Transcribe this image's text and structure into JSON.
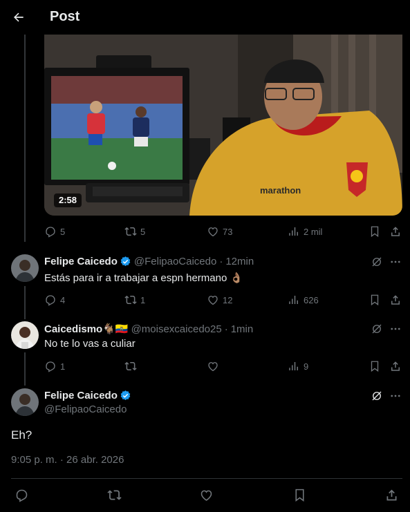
{
  "header": {
    "title": "Post"
  },
  "video": {
    "duration": "2:58",
    "jersey_text": "marathon"
  },
  "main_post_actions": {
    "replies": "5",
    "reposts": "5",
    "likes": "73",
    "views": "2 mil"
  },
  "replies": [
    {
      "name": "Felipe Caicedo",
      "handle": "@FelipaoCaicedo",
      "time": "12min",
      "text": "Estás para ir a trabajar a espn hermano 👌🏽",
      "actions": {
        "replies": "4",
        "reposts": "1",
        "likes": "12",
        "views": "626"
      }
    },
    {
      "name": "Caicedismo🐐🇪🇨",
      "handle": "@moisexcaicedo25",
      "time": "1min",
      "text": "No te lo vas a culiar",
      "actions": {
        "replies": "1",
        "reposts": "",
        "likes": "",
        "views": "9"
      }
    }
  ],
  "focused_post": {
    "name": "Felipe Caicedo",
    "handle": "@FelipaoCaicedo",
    "text": "Eh?",
    "timestamp": "9:05 p. m. · 26 abr. 2026"
  },
  "separator": "·",
  "colors": {
    "background": "#000000",
    "text": "#e7e9ea",
    "muted": "#71767b",
    "verified": "#1d9bf0",
    "divider": "#2f3336"
  }
}
